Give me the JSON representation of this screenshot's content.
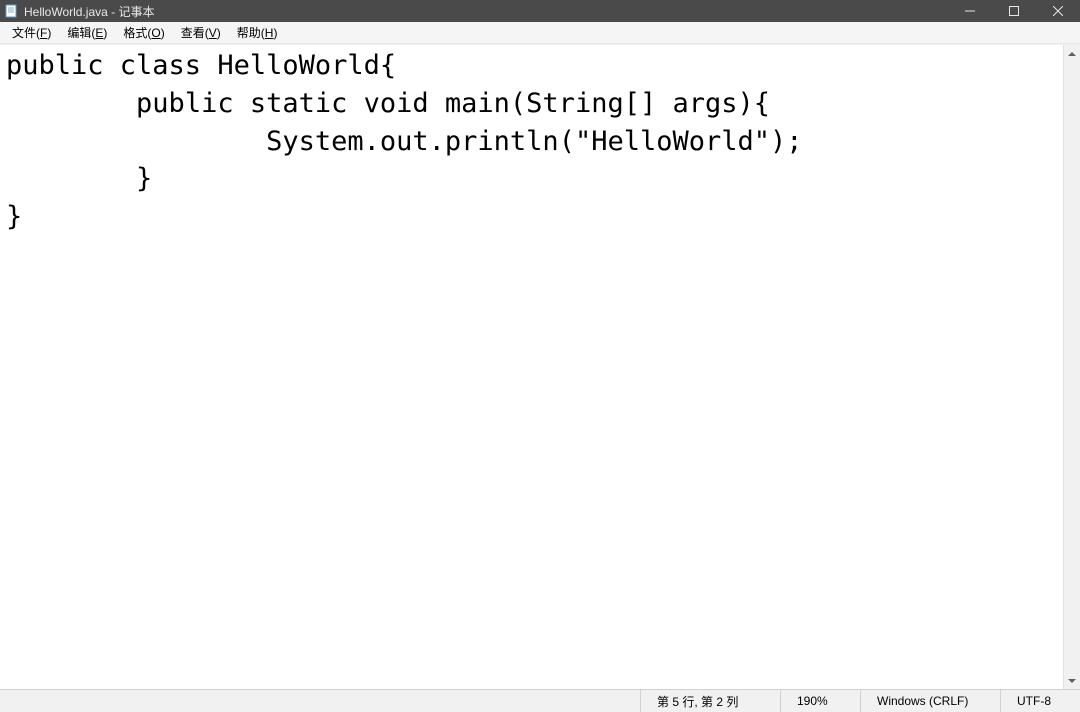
{
  "titlebar": {
    "title": "HelloWorld.java - 记事本"
  },
  "menu": {
    "file": {
      "label": "文件",
      "accel": "F"
    },
    "edit": {
      "label": "编辑",
      "accel": "E"
    },
    "format": {
      "label": "格式",
      "accel": "O"
    },
    "view": {
      "label": "查看",
      "accel": "V"
    },
    "help": {
      "label": "帮助",
      "accel": "H"
    }
  },
  "editor": {
    "content": "public class HelloWorld{\n\tpublic static void main(String[] args){\n\t\tSystem.out.println(\"HelloWorld\");\n\t}\n}"
  },
  "statusbar": {
    "position": "第 5 行, 第 2 列",
    "zoom": "190%",
    "line_ending": "Windows (CRLF)",
    "encoding": "UTF-8"
  }
}
